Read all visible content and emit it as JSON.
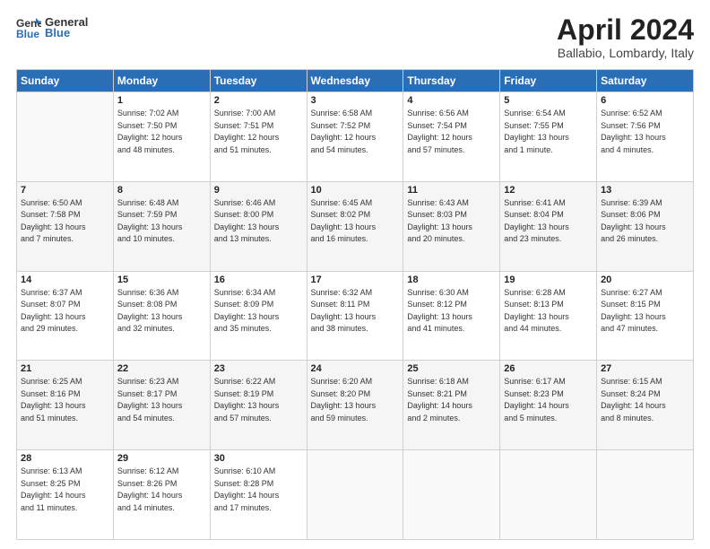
{
  "logo": {
    "general": "General",
    "blue": "Blue"
  },
  "header": {
    "month": "April 2024",
    "location": "Ballabio, Lombardy, Italy"
  },
  "days_of_week": [
    "Sunday",
    "Monday",
    "Tuesday",
    "Wednesday",
    "Thursday",
    "Friday",
    "Saturday"
  ],
  "weeks": [
    [
      {
        "day": "",
        "info": ""
      },
      {
        "day": "1",
        "info": "Sunrise: 7:02 AM\nSunset: 7:50 PM\nDaylight: 12 hours\nand 48 minutes."
      },
      {
        "day": "2",
        "info": "Sunrise: 7:00 AM\nSunset: 7:51 PM\nDaylight: 12 hours\nand 51 minutes."
      },
      {
        "day": "3",
        "info": "Sunrise: 6:58 AM\nSunset: 7:52 PM\nDaylight: 12 hours\nand 54 minutes."
      },
      {
        "day": "4",
        "info": "Sunrise: 6:56 AM\nSunset: 7:54 PM\nDaylight: 12 hours\nand 57 minutes."
      },
      {
        "day": "5",
        "info": "Sunrise: 6:54 AM\nSunset: 7:55 PM\nDaylight: 13 hours\nand 1 minute."
      },
      {
        "day": "6",
        "info": "Sunrise: 6:52 AM\nSunset: 7:56 PM\nDaylight: 13 hours\nand 4 minutes."
      }
    ],
    [
      {
        "day": "7",
        "info": "Sunrise: 6:50 AM\nSunset: 7:58 PM\nDaylight: 13 hours\nand 7 minutes."
      },
      {
        "day": "8",
        "info": "Sunrise: 6:48 AM\nSunset: 7:59 PM\nDaylight: 13 hours\nand 10 minutes."
      },
      {
        "day": "9",
        "info": "Sunrise: 6:46 AM\nSunset: 8:00 PM\nDaylight: 13 hours\nand 13 minutes."
      },
      {
        "day": "10",
        "info": "Sunrise: 6:45 AM\nSunset: 8:02 PM\nDaylight: 13 hours\nand 16 minutes."
      },
      {
        "day": "11",
        "info": "Sunrise: 6:43 AM\nSunset: 8:03 PM\nDaylight: 13 hours\nand 20 minutes."
      },
      {
        "day": "12",
        "info": "Sunrise: 6:41 AM\nSunset: 8:04 PM\nDaylight: 13 hours\nand 23 minutes."
      },
      {
        "day": "13",
        "info": "Sunrise: 6:39 AM\nSunset: 8:06 PM\nDaylight: 13 hours\nand 26 minutes."
      }
    ],
    [
      {
        "day": "14",
        "info": "Sunrise: 6:37 AM\nSunset: 8:07 PM\nDaylight: 13 hours\nand 29 minutes."
      },
      {
        "day": "15",
        "info": "Sunrise: 6:36 AM\nSunset: 8:08 PM\nDaylight: 13 hours\nand 32 minutes."
      },
      {
        "day": "16",
        "info": "Sunrise: 6:34 AM\nSunset: 8:09 PM\nDaylight: 13 hours\nand 35 minutes."
      },
      {
        "day": "17",
        "info": "Sunrise: 6:32 AM\nSunset: 8:11 PM\nDaylight: 13 hours\nand 38 minutes."
      },
      {
        "day": "18",
        "info": "Sunrise: 6:30 AM\nSunset: 8:12 PM\nDaylight: 13 hours\nand 41 minutes."
      },
      {
        "day": "19",
        "info": "Sunrise: 6:28 AM\nSunset: 8:13 PM\nDaylight: 13 hours\nand 44 minutes."
      },
      {
        "day": "20",
        "info": "Sunrise: 6:27 AM\nSunset: 8:15 PM\nDaylight: 13 hours\nand 47 minutes."
      }
    ],
    [
      {
        "day": "21",
        "info": "Sunrise: 6:25 AM\nSunset: 8:16 PM\nDaylight: 13 hours\nand 51 minutes."
      },
      {
        "day": "22",
        "info": "Sunrise: 6:23 AM\nSunset: 8:17 PM\nDaylight: 13 hours\nand 54 minutes."
      },
      {
        "day": "23",
        "info": "Sunrise: 6:22 AM\nSunset: 8:19 PM\nDaylight: 13 hours\nand 57 minutes."
      },
      {
        "day": "24",
        "info": "Sunrise: 6:20 AM\nSunset: 8:20 PM\nDaylight: 13 hours\nand 59 minutes."
      },
      {
        "day": "25",
        "info": "Sunrise: 6:18 AM\nSunset: 8:21 PM\nDaylight: 14 hours\nand 2 minutes."
      },
      {
        "day": "26",
        "info": "Sunrise: 6:17 AM\nSunset: 8:23 PM\nDaylight: 14 hours\nand 5 minutes."
      },
      {
        "day": "27",
        "info": "Sunrise: 6:15 AM\nSunset: 8:24 PM\nDaylight: 14 hours\nand 8 minutes."
      }
    ],
    [
      {
        "day": "28",
        "info": "Sunrise: 6:13 AM\nSunset: 8:25 PM\nDaylight: 14 hours\nand 11 minutes."
      },
      {
        "day": "29",
        "info": "Sunrise: 6:12 AM\nSunset: 8:26 PM\nDaylight: 14 hours\nand 14 minutes."
      },
      {
        "day": "30",
        "info": "Sunrise: 6:10 AM\nSunset: 8:28 PM\nDaylight: 14 hours\nand 17 minutes."
      },
      {
        "day": "",
        "info": ""
      },
      {
        "day": "",
        "info": ""
      },
      {
        "day": "",
        "info": ""
      },
      {
        "day": "",
        "info": ""
      }
    ]
  ]
}
